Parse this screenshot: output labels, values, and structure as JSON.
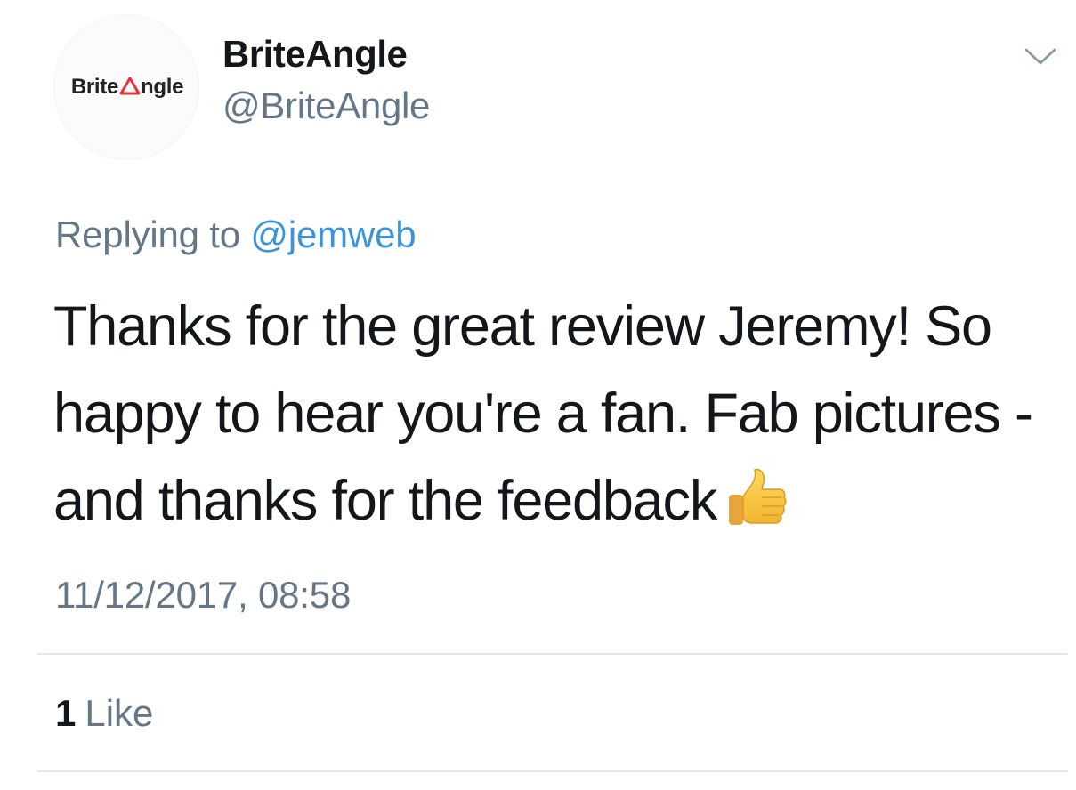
{
  "tweet": {
    "author": {
      "avatar_logo_left": "Brite",
      "avatar_logo_right": "ngle",
      "display_name": "BriteAngle",
      "handle": "@BriteAngle"
    },
    "reply": {
      "prefix": "Replying to",
      "mention": "@jemweb"
    },
    "text": "Thanks for the great review Jeremy! So happy to hear you're a fan. Fab pictures - and thanks for the feedback",
    "emoji_icon": "thumbs-up-emoji",
    "timestamp": "11/12/2017, 08:58",
    "likes": {
      "count": "1",
      "label": "Like"
    }
  },
  "colors": {
    "secondary_text": "#657786",
    "link": "#3b94d9",
    "logo_triangle": "#e8313a",
    "divider": "#e1e8ed"
  }
}
